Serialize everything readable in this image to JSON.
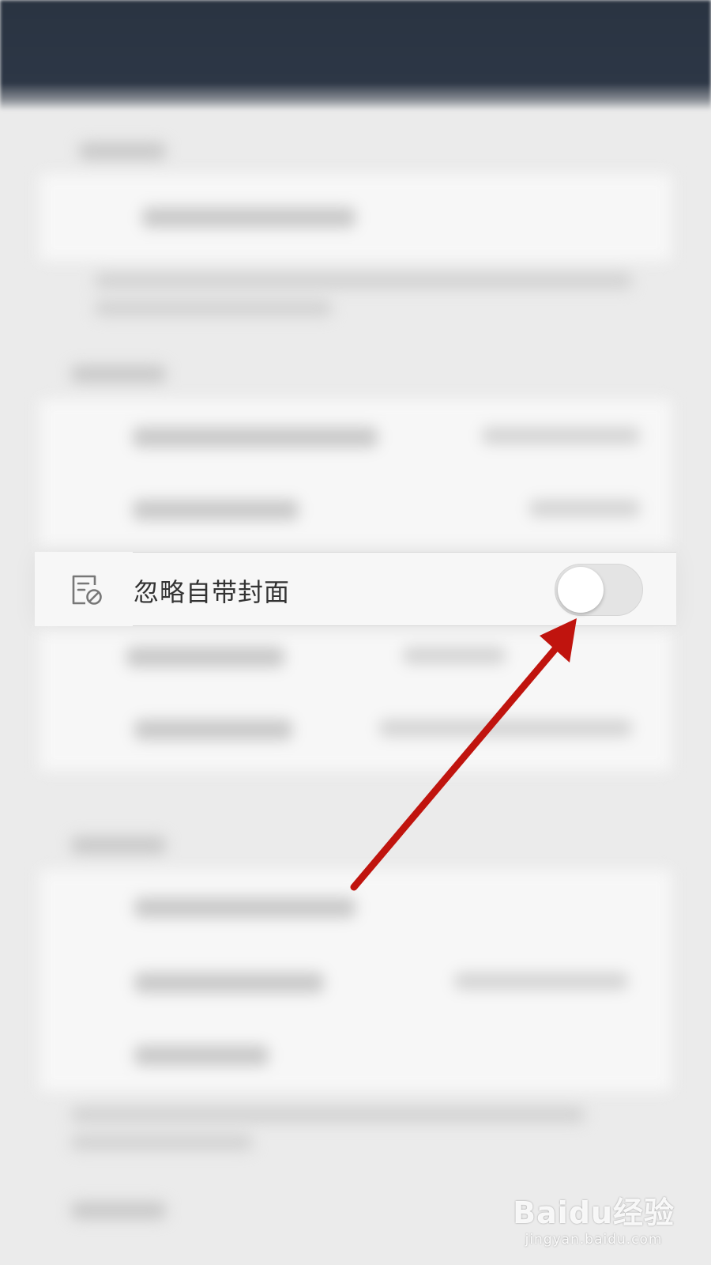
{
  "setting_row": {
    "label": "忽略自带封面",
    "icon": "cover-ignore-icon",
    "toggle": {
      "state": "off",
      "track_color": "#e4e4e4",
      "knob_color": "#ffffff"
    }
  },
  "annotation": {
    "type": "arrow",
    "color": "#c0140e"
  },
  "watermark": {
    "brand": "Baidu经验",
    "url": "jingyan.baidu.com"
  }
}
